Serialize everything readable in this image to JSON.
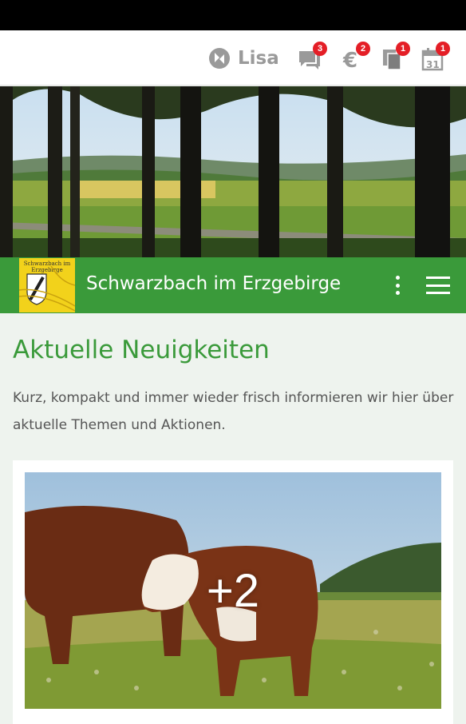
{
  "top_bar": {
    "user_name": "Lisa",
    "icons": [
      {
        "name": "chat-icon",
        "badge": "3"
      },
      {
        "name": "euro-icon",
        "badge": "2"
      },
      {
        "name": "documents-icon",
        "badge": "1"
      },
      {
        "name": "calendar-icon",
        "badge": "1",
        "day": "31"
      }
    ]
  },
  "header": {
    "logo_text": "Schwarzbach im Erzgebirge",
    "title": "Schwarzbach im Erzgebirge"
  },
  "main": {
    "section_title": "Aktuelle Neuigkeiten",
    "intro": "Kurz, kompakt und immer wieder frisch informieren wir hier über aktuelle Themen und Aktionen.",
    "news_card": {
      "more_images": "+2"
    }
  },
  "colors": {
    "accent_green": "#3a9a3a",
    "badge_red": "#e41e26",
    "logo_yellow": "#f2d21b",
    "background": "#eef3ee"
  }
}
